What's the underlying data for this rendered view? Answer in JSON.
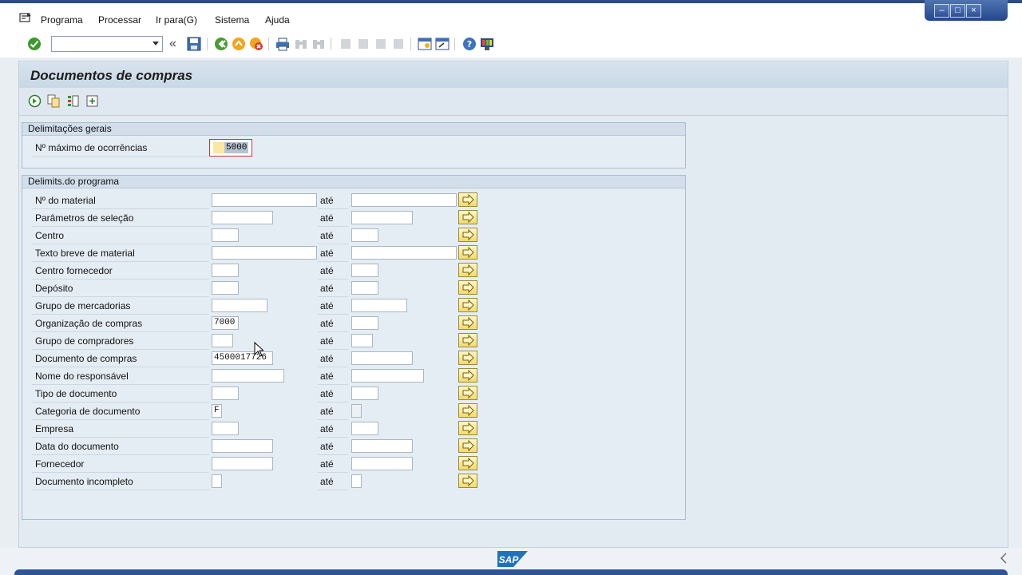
{
  "menu": {
    "items": [
      "Programa",
      "Processar",
      "Ir para(G)",
      "Sistema",
      "Ajuda"
    ]
  },
  "toolbar": {
    "command_field_value": ""
  },
  "page": {
    "title": "Documentos de compras"
  },
  "general": {
    "title": "Delimitações gerais",
    "max_label": "Nº máximo de ocorrências",
    "max_value": "5000"
  },
  "program": {
    "title": "Delimits.do programa",
    "ate": "até",
    "rows": [
      {
        "label": "Nº do material",
        "from": "",
        "to": ""
      },
      {
        "label": "Parâmetros de seleção",
        "from": "",
        "to": ""
      },
      {
        "label": "Centro",
        "from": "",
        "to": ""
      },
      {
        "label": "Texto breve de material",
        "from": "",
        "to": ""
      },
      {
        "label": "Centro fornecedor",
        "from": "",
        "to": ""
      },
      {
        "label": "Depósito",
        "from": "",
        "to": ""
      },
      {
        "label": "Grupo de mercadorias",
        "from": "",
        "to": ""
      },
      {
        "label": "Organização de compras",
        "from": "7000",
        "to": ""
      },
      {
        "label": "Grupo de compradores",
        "from": "",
        "to": ""
      },
      {
        "label": "Documento de compras",
        "from": "4500017726",
        "to": ""
      },
      {
        "label": "Nome do responsável",
        "from": "",
        "to": ""
      },
      {
        "label": "Tipo de documento",
        "from": "",
        "to": ""
      },
      {
        "label": "Categoria de documento",
        "from": "F",
        "to": ""
      },
      {
        "label": "Empresa",
        "from": "",
        "to": ""
      },
      {
        "label": "Data do documento",
        "from": "",
        "to": ""
      },
      {
        "label": "Fornecedor",
        "from": "",
        "to": ""
      },
      {
        "label": "Documento incompleto",
        "from": "",
        "to": ""
      }
    ]
  },
  "footer": {
    "logo_text": "SAP"
  }
}
